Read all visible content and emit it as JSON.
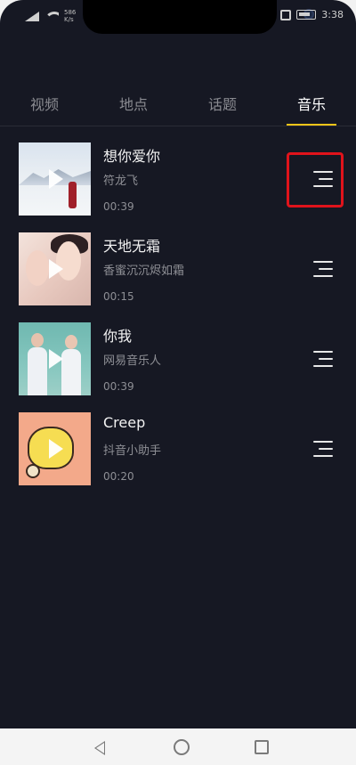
{
  "status_bar": {
    "network_speed": "586 K/s",
    "time": "3:38"
  },
  "tabs": [
    {
      "label": "视频",
      "active": false
    },
    {
      "label": "地点",
      "active": false
    },
    {
      "label": "话题",
      "active": false
    },
    {
      "label": "音乐",
      "active": true
    }
  ],
  "accent_color": "#f5c518",
  "highlight_color": "#e0131b",
  "songs": [
    {
      "title": "想你爱你",
      "artist": "符龙飞",
      "duration": "00:39"
    },
    {
      "title": "天地无霜",
      "artist": "香蜜沉沉烬如霜",
      "duration": "00:15"
    },
    {
      "title": "你我",
      "artist": "网易音乐人",
      "duration": "00:39"
    },
    {
      "title": "Creep",
      "artist": "抖音小助手",
      "duration": "00:20"
    }
  ],
  "icons": {
    "play": "play-icon",
    "menu": "menu-lines-icon",
    "nav_back": "back-triangle-icon",
    "nav_home": "home-circle-icon",
    "nav_recent": "recent-square-icon"
  }
}
